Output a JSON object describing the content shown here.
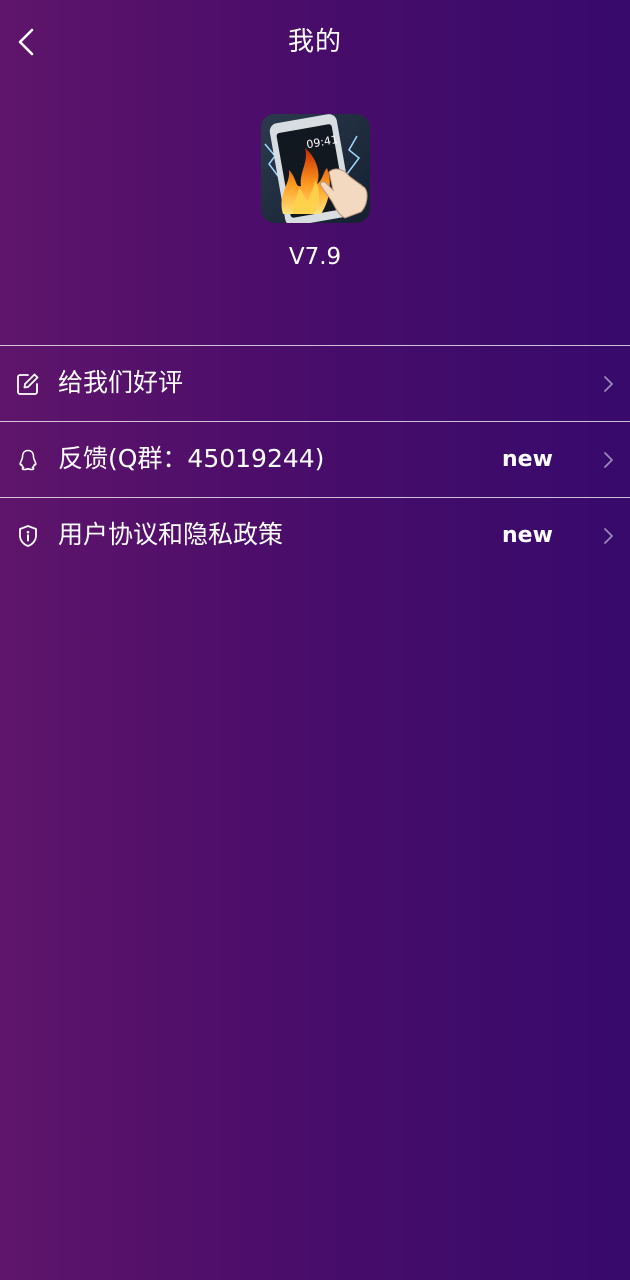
{
  "header": {
    "title": "我的",
    "back_icon": "chevron-left-icon"
  },
  "app": {
    "icon": "fire-phone-app-icon",
    "version": "V7.9"
  },
  "menu": {
    "items": [
      {
        "icon": "edit-icon",
        "label": "给我们好评",
        "badge": ""
      },
      {
        "icon": "qq-penguin-icon",
        "label": "反馈(Q群：45019244)",
        "badge": "new"
      },
      {
        "icon": "shield-info-icon",
        "label": "用户协议和隐私政策",
        "badge": "new"
      }
    ]
  },
  "colors": {
    "background_left": "#5f156b",
    "background_right": "#370a6c",
    "text": "#ffffff",
    "divider": "#ffffff",
    "chevron": "#9b86b8"
  }
}
